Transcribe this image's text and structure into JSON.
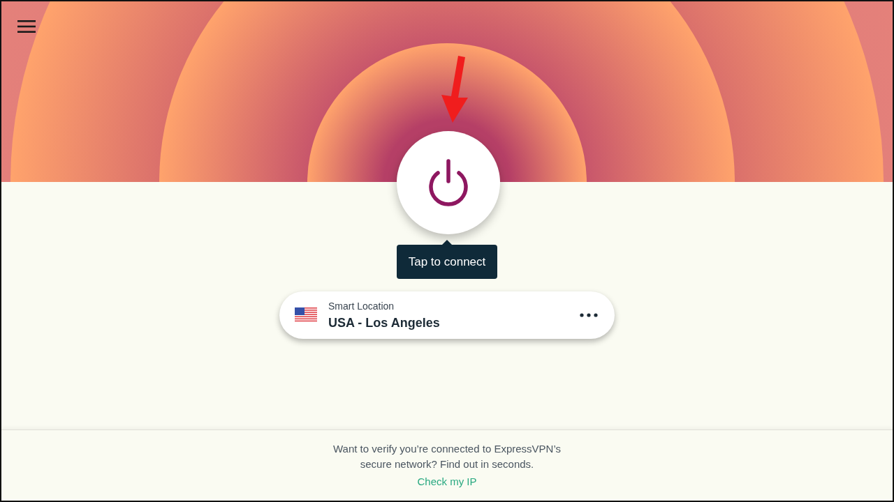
{
  "connect_hint": "Tap to connect",
  "location": {
    "label": "Smart Location",
    "name": "USA - Los Angeles"
  },
  "footer": {
    "message": "Want to verify you’re connected to ExpressVPN’s secure network? Find out in seconds.",
    "link": "Check my IP"
  }
}
